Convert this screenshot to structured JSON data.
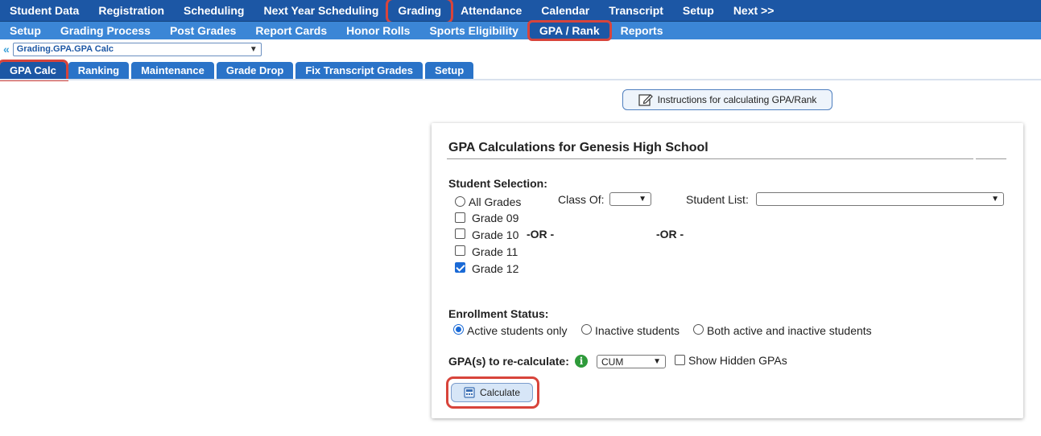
{
  "topnav": {
    "items": [
      "Student Data",
      "Registration",
      "Scheduling",
      "Next Year Scheduling",
      "Grading",
      "Attendance",
      "Calendar",
      "Transcript",
      "Setup",
      "Next >>"
    ]
  },
  "subnav": {
    "items": [
      "Setup",
      "Grading Process",
      "Post Grades",
      "Report Cards",
      "Honor Rolls",
      "Sports Eligibility",
      "GPA / Rank",
      "Reports"
    ]
  },
  "breadcrumb": {
    "value": "Grading.GPA.GPA Calc"
  },
  "tabs": [
    "GPA Calc",
    "Ranking",
    "Maintenance",
    "Grade Drop",
    "Fix Transcript Grades",
    "Setup"
  ],
  "instructions_button": "Instructions for calculating GPA/Rank",
  "panel": {
    "title": "GPA Calculations for Genesis High School",
    "student_selection": {
      "heading": "Student Selection:",
      "all_grades": "All Grades",
      "class_of_label": "Class Of:",
      "class_of_value": "",
      "student_list_label": "Student List:",
      "student_list_value": "",
      "grades": [
        {
          "label": "Grade 09",
          "checked": false
        },
        {
          "label": "Grade 10",
          "checked": false
        },
        {
          "label": "Grade 11",
          "checked": false
        },
        {
          "label": "Grade 12",
          "checked": true
        }
      ],
      "or_label_1": "-OR -",
      "or_label_2": "-OR -"
    },
    "enrollment": {
      "heading": "Enrollment Status:",
      "options": [
        "Active students only",
        "Inactive students",
        "Both active and inactive students"
      ],
      "selected_index": 0
    },
    "gpa": {
      "label": "GPA(s) to re-calculate:",
      "info_icon": "i",
      "select_value": "CUM",
      "show_hidden_label": "Show Hidden GPAs"
    },
    "calculate_button": "Calculate"
  },
  "colors": {
    "topnav_bg": "#1c57a5",
    "subnav_bg": "#3b86d6",
    "highlight": "#d8443b",
    "info_green": "#2e9a3a"
  }
}
